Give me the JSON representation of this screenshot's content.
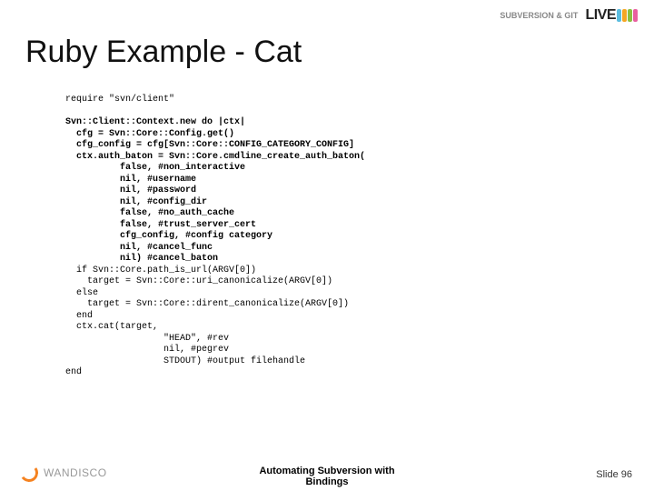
{
  "header": {
    "logo_text": "SUBVERSION & GIT",
    "live": "LIVE"
  },
  "title": "Ruby Example - Cat",
  "code": {
    "require_line": "require \"svn/client\"",
    "block_open": "Svn::Client::Context.new do |ctx|",
    "cfg_line": "  cfg = Svn::Core::Config.get()",
    "cfg_config": "  cfg_config = cfg[Svn::Core::CONFIG_CATEGORY_CONFIG]",
    "auth_baton": "  ctx.auth_baton = Svn::Core.cmdline_create_auth_baton(",
    "p1": "          false, #non_interactive",
    "p2": "          nil, #username",
    "p3": "          nil, #password",
    "p4": "          nil, #config_dir",
    "p5": "          false, #no_auth_cache",
    "p6": "          false, #trust_server_cert",
    "p7": "          cfg_config, #config category",
    "p8": "          nil, #cancel_func",
    "p9": "          nil) #cancel_baton",
    "if_line": "  if Svn::Core.path_is_url(ARGV[0])",
    "t1": "    target = Svn::Core::uri_canonicalize(ARGV[0])",
    "else_line": "  else",
    "t2": "    target = Svn::Core::dirent_canonicalize(ARGV[0])",
    "end1": "  end",
    "cat": "  ctx.cat(target,",
    "cat_a": "                  \"HEAD\", #rev",
    "cat_b": "                  nil, #pegrev",
    "cat_c": "                  STDOUT) #output filehandle",
    "end2": "end"
  },
  "footer": {
    "brand": "WANDISCO",
    "center_top": "Automating Subversion with",
    "center_bottom": "Bindings",
    "slide_label": "Slide 96"
  }
}
